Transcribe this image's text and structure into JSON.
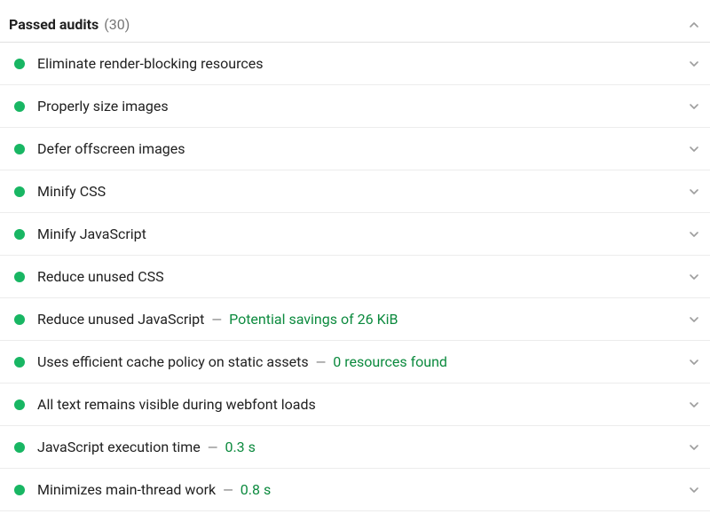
{
  "header": {
    "title": "Passed audits",
    "count": "(30)"
  },
  "audits": [
    {
      "label": "Eliminate render-blocking resources"
    },
    {
      "label": "Properly size images"
    },
    {
      "label": "Defer offscreen images"
    },
    {
      "label": "Minify CSS"
    },
    {
      "label": "Minify JavaScript"
    },
    {
      "label": "Reduce unused CSS"
    },
    {
      "label": "Reduce unused JavaScript",
      "detail": "Potential savings of 26 KiB"
    },
    {
      "label": "Uses efficient cache policy on static assets",
      "detail": "0 resources found"
    },
    {
      "label": "All text remains visible during webfont loads"
    },
    {
      "label": "JavaScript execution time",
      "detail": "0.3 s"
    },
    {
      "label": "Minimizes main-thread work",
      "detail": "0.8 s"
    }
  ],
  "dash": "—"
}
